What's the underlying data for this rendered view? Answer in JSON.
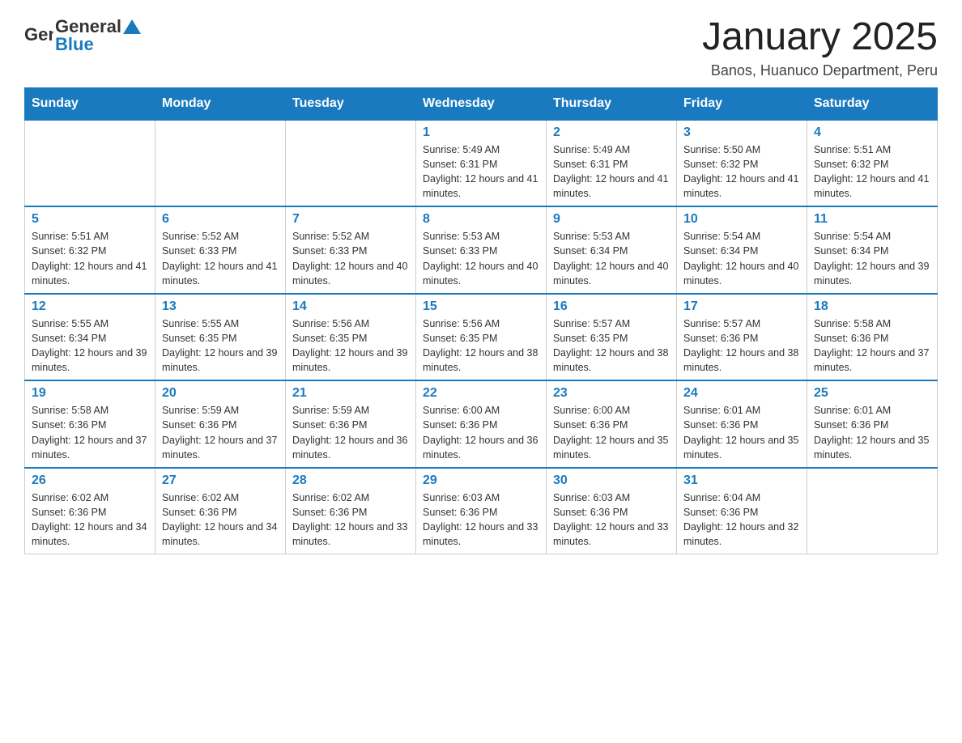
{
  "header": {
    "logo_general": "General",
    "logo_blue": "Blue",
    "title": "January 2025",
    "subtitle": "Banos, Huanuco Department, Peru"
  },
  "columns": [
    "Sunday",
    "Monday",
    "Tuesday",
    "Wednesday",
    "Thursday",
    "Friday",
    "Saturday"
  ],
  "weeks": [
    [
      {
        "day": "",
        "info": ""
      },
      {
        "day": "",
        "info": ""
      },
      {
        "day": "",
        "info": ""
      },
      {
        "day": "1",
        "info": "Sunrise: 5:49 AM\nSunset: 6:31 PM\nDaylight: 12 hours and 41 minutes."
      },
      {
        "day": "2",
        "info": "Sunrise: 5:49 AM\nSunset: 6:31 PM\nDaylight: 12 hours and 41 minutes."
      },
      {
        "day": "3",
        "info": "Sunrise: 5:50 AM\nSunset: 6:32 PM\nDaylight: 12 hours and 41 minutes."
      },
      {
        "day": "4",
        "info": "Sunrise: 5:51 AM\nSunset: 6:32 PM\nDaylight: 12 hours and 41 minutes."
      }
    ],
    [
      {
        "day": "5",
        "info": "Sunrise: 5:51 AM\nSunset: 6:32 PM\nDaylight: 12 hours and 41 minutes."
      },
      {
        "day": "6",
        "info": "Sunrise: 5:52 AM\nSunset: 6:33 PM\nDaylight: 12 hours and 41 minutes."
      },
      {
        "day": "7",
        "info": "Sunrise: 5:52 AM\nSunset: 6:33 PM\nDaylight: 12 hours and 40 minutes."
      },
      {
        "day": "8",
        "info": "Sunrise: 5:53 AM\nSunset: 6:33 PM\nDaylight: 12 hours and 40 minutes."
      },
      {
        "day": "9",
        "info": "Sunrise: 5:53 AM\nSunset: 6:34 PM\nDaylight: 12 hours and 40 minutes."
      },
      {
        "day": "10",
        "info": "Sunrise: 5:54 AM\nSunset: 6:34 PM\nDaylight: 12 hours and 40 minutes."
      },
      {
        "day": "11",
        "info": "Sunrise: 5:54 AM\nSunset: 6:34 PM\nDaylight: 12 hours and 39 minutes."
      }
    ],
    [
      {
        "day": "12",
        "info": "Sunrise: 5:55 AM\nSunset: 6:34 PM\nDaylight: 12 hours and 39 minutes."
      },
      {
        "day": "13",
        "info": "Sunrise: 5:55 AM\nSunset: 6:35 PM\nDaylight: 12 hours and 39 minutes."
      },
      {
        "day": "14",
        "info": "Sunrise: 5:56 AM\nSunset: 6:35 PM\nDaylight: 12 hours and 39 minutes."
      },
      {
        "day": "15",
        "info": "Sunrise: 5:56 AM\nSunset: 6:35 PM\nDaylight: 12 hours and 38 minutes."
      },
      {
        "day": "16",
        "info": "Sunrise: 5:57 AM\nSunset: 6:35 PM\nDaylight: 12 hours and 38 minutes."
      },
      {
        "day": "17",
        "info": "Sunrise: 5:57 AM\nSunset: 6:36 PM\nDaylight: 12 hours and 38 minutes."
      },
      {
        "day": "18",
        "info": "Sunrise: 5:58 AM\nSunset: 6:36 PM\nDaylight: 12 hours and 37 minutes."
      }
    ],
    [
      {
        "day": "19",
        "info": "Sunrise: 5:58 AM\nSunset: 6:36 PM\nDaylight: 12 hours and 37 minutes."
      },
      {
        "day": "20",
        "info": "Sunrise: 5:59 AM\nSunset: 6:36 PM\nDaylight: 12 hours and 37 minutes."
      },
      {
        "day": "21",
        "info": "Sunrise: 5:59 AM\nSunset: 6:36 PM\nDaylight: 12 hours and 36 minutes."
      },
      {
        "day": "22",
        "info": "Sunrise: 6:00 AM\nSunset: 6:36 PM\nDaylight: 12 hours and 36 minutes."
      },
      {
        "day": "23",
        "info": "Sunrise: 6:00 AM\nSunset: 6:36 PM\nDaylight: 12 hours and 35 minutes."
      },
      {
        "day": "24",
        "info": "Sunrise: 6:01 AM\nSunset: 6:36 PM\nDaylight: 12 hours and 35 minutes."
      },
      {
        "day": "25",
        "info": "Sunrise: 6:01 AM\nSunset: 6:36 PM\nDaylight: 12 hours and 35 minutes."
      }
    ],
    [
      {
        "day": "26",
        "info": "Sunrise: 6:02 AM\nSunset: 6:36 PM\nDaylight: 12 hours and 34 minutes."
      },
      {
        "day": "27",
        "info": "Sunrise: 6:02 AM\nSunset: 6:36 PM\nDaylight: 12 hours and 34 minutes."
      },
      {
        "day": "28",
        "info": "Sunrise: 6:02 AM\nSunset: 6:36 PM\nDaylight: 12 hours and 33 minutes."
      },
      {
        "day": "29",
        "info": "Sunrise: 6:03 AM\nSunset: 6:36 PM\nDaylight: 12 hours and 33 minutes."
      },
      {
        "day": "30",
        "info": "Sunrise: 6:03 AM\nSunset: 6:36 PM\nDaylight: 12 hours and 33 minutes."
      },
      {
        "day": "31",
        "info": "Sunrise: 6:04 AM\nSunset: 6:36 PM\nDaylight: 12 hours and 32 minutes."
      },
      {
        "day": "",
        "info": ""
      }
    ]
  ]
}
